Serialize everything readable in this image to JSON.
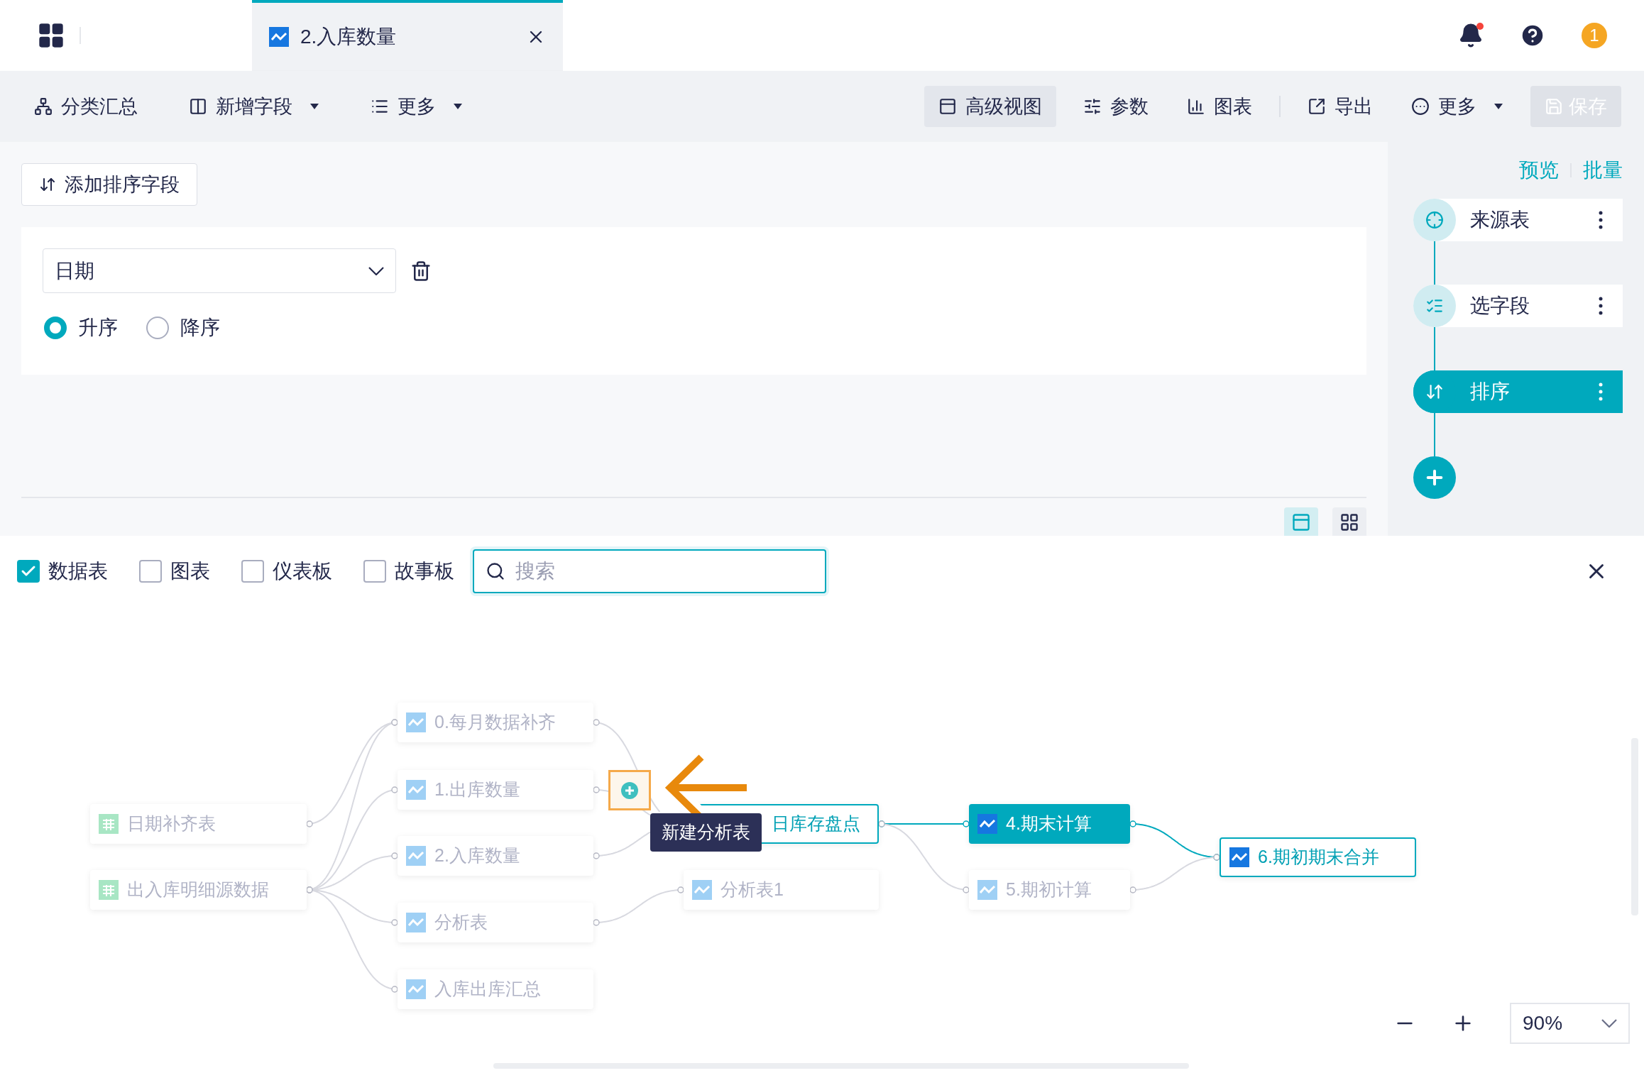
{
  "tabs": [
    {
      "label": "2.入库数量",
      "selected": true
    }
  ],
  "header": {
    "avatar_text": "1",
    "notification_dot": true
  },
  "toolbar": {
    "left": [
      {
        "label": "分类汇总",
        "kind": "group",
        "dropdown": false
      },
      {
        "label": "新增字段",
        "kind": "add",
        "dropdown": true
      },
      {
        "label": "更多",
        "kind": "list",
        "dropdown": true
      }
    ],
    "right": [
      {
        "label": "高级视图",
        "kind": "view",
        "selected": true,
        "disabled": false
      },
      {
        "label": "参数",
        "kind": "params",
        "selected": false,
        "disabled": false
      },
      {
        "label": "图表",
        "kind": "chart",
        "selected": false,
        "disabled": false
      },
      {
        "label": "导出",
        "kind": "export",
        "selected": false,
        "disabled": false
      },
      {
        "label": "更多",
        "kind": "more",
        "selected": false,
        "disabled": false,
        "dropdown": true
      },
      {
        "label": "保存",
        "kind": "save",
        "disabled": true
      }
    ]
  },
  "sort_editor": {
    "add_button": "添加排序字段",
    "field": "日期",
    "orders": [
      {
        "label": "升序",
        "selected": true
      },
      {
        "label": "降序",
        "selected": false
      }
    ]
  },
  "pipeline": {
    "links": [
      "预览",
      "批量"
    ],
    "steps": [
      {
        "label": "来源表",
        "kind": "source",
        "selected": false
      },
      {
        "label": "选字段",
        "kind": "fields",
        "selected": false
      },
      {
        "label": "排序",
        "kind": "sort",
        "selected": true
      }
    ]
  },
  "layout_toggles": [
    {
      "kind": "stacked",
      "selected": true
    },
    {
      "kind": "grid",
      "selected": false
    }
  ],
  "filters": [
    {
      "label": "数据表",
      "checked": true
    },
    {
      "label": "图表",
      "checked": false
    },
    {
      "label": "仪表板",
      "checked": false
    },
    {
      "label": "故事板",
      "checked": false
    }
  ],
  "search": {
    "placeholder": "搜索"
  },
  "lineage": {
    "nodes": [
      {
        "label": "日期补齐表",
        "kind": "table",
        "selected": false,
        "highlighted": false
      },
      {
        "label": "出入库明细源数据",
        "kind": "table",
        "selected": false,
        "highlighted": false
      },
      {
        "label": "0.每月数据补齐",
        "kind": "analysis",
        "selected": false,
        "highlighted": false
      },
      {
        "label": "1.出库数量",
        "kind": "analysis",
        "selected": false,
        "highlighted": false
      },
      {
        "label": "2.入库数量",
        "kind": "analysis",
        "selected": false,
        "highlighted": false
      },
      {
        "label": "分析表",
        "kind": "analysis",
        "selected": false,
        "highlighted": false
      },
      {
        "label": "入库出库汇总",
        "kind": "analysis",
        "selected": false,
        "highlighted": false
      },
      {
        "label": "日库存盘点",
        "selected": false,
        "highlighted": true
      },
      {
        "label": "分析表1",
        "kind": "analysis",
        "selected": false,
        "highlighted": false
      },
      {
        "label": "4.期末计算",
        "kind": "analysis",
        "selected": true,
        "highlighted": false
      },
      {
        "label": "5.期初计算",
        "kind": "analysis",
        "selected": false,
        "highlighted": false
      },
      {
        "label": "6.期初期末合并",
        "kind": "analysis",
        "selected": false,
        "highlighted": true
      }
    ],
    "edges": [
      {
        "highlighted": false
      },
      {
        "highlighted": false
      },
      {
        "highlighted": false
      },
      {
        "highlighted": false
      },
      {
        "highlighted": false
      },
      {
        "highlighted": false
      },
      {
        "highlighted": false
      },
      {
        "highlighted": false
      },
      {
        "highlighted": false
      },
      {
        "highlighted": false
      },
      {
        "highlighted": true
      },
      {
        "highlighted": false
      },
      {
        "highlighted": true
      },
      {
        "highlighted": false
      }
    ],
    "tooltip": "新建分析表"
  },
  "zoom": {
    "value": "90%"
  }
}
